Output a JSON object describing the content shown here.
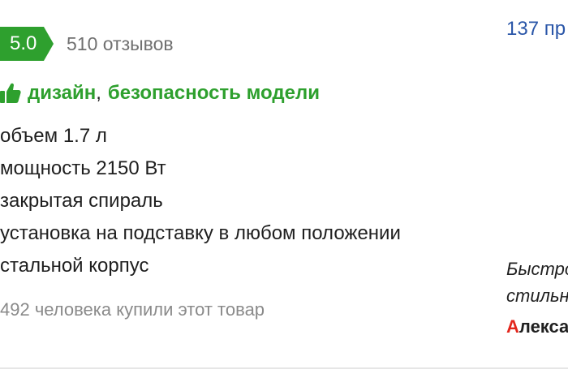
{
  "rating": {
    "value": "5.0",
    "reviews": "510 отзывов",
    "badge_color": "#2ea02e"
  },
  "pros": {
    "icon": "thumbs-up-icon",
    "items": [
      "дизайн",
      "безопасность модели"
    ],
    "separator": ","
  },
  "specs": [
    "объем 1.7 л",
    "мощность 2150 Вт",
    "закрытая спираль",
    "установка на подставку в любом положении",
    "стальной корпус"
  ],
  "bought_text": "492 человека купили этот товар",
  "sidebar": {
    "offers_link": "137 пр",
    "quote_lines": [
      "Быстро",
      "стильн"
    ],
    "author_first_letter": "А",
    "author_rest": "лекса"
  }
}
